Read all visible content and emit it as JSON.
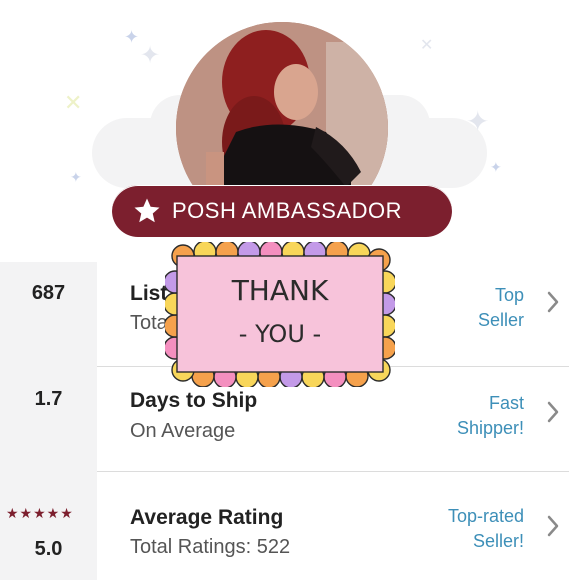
{
  "profile": {
    "badge_label": "POSH AMBASSADOR"
  },
  "stats": [
    {
      "value": "687",
      "title": "List",
      "subtitle": "Tota",
      "badge_line1": "Top",
      "badge_line2": "Seller"
    },
    {
      "value": "1.7",
      "title": "Days to Ship",
      "subtitle": "On Average",
      "badge_line1": "Fast",
      "badge_line2": "Shipper!"
    },
    {
      "value": "5.0",
      "title": "Average Rating",
      "subtitle": "Total Ratings: 522",
      "badge_line1": "Top-rated",
      "badge_line2": "Seller!",
      "stars": "★★★★★"
    }
  ],
  "note": {
    "line1": "THANK",
    "line2": "- YOU -"
  },
  "colors": {
    "badge": "#7c1f2e",
    "link": "#3d8fb8",
    "note_fill": "#f7c3da",
    "note_scallop_yellow": "#f8d65a",
    "note_scallop_orange": "#f5a14c",
    "note_scallop_purple": "#c39ae8",
    "note_scallop_pink": "#f48fbf"
  },
  "icons": [
    "star-icon",
    "chevron-right-icon"
  ]
}
